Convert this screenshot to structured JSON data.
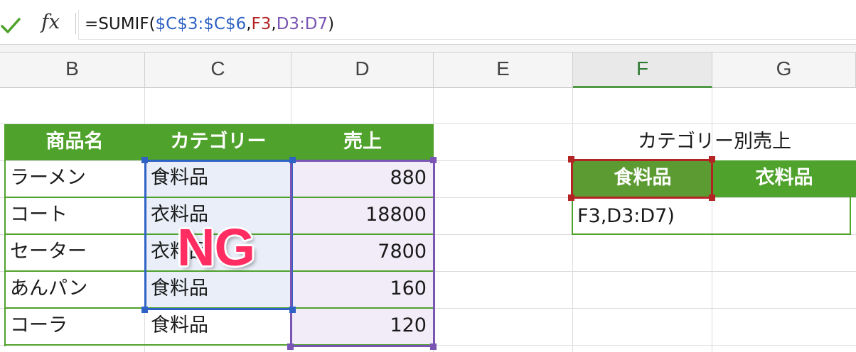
{
  "formula_bar": {
    "check_icon": "checkmark-icon",
    "fx_label": "fx",
    "formula_prefix": "=SUMIF(",
    "formula_ref_range": "$C$3:$C$6",
    "formula_comma1": ",",
    "formula_ref_criteria": "F3",
    "formula_comma2": ",",
    "formula_ref_sum": "D3:D7",
    "formula_suffix": ")"
  },
  "columns": [
    "B",
    "C",
    "D",
    "E",
    "F",
    "G"
  ],
  "selected_column": "F",
  "table": {
    "headers": [
      "商品名",
      "カテゴリー",
      "売上"
    ],
    "rows": [
      {
        "name": "ラーメン",
        "category": "食料品",
        "sales": "880"
      },
      {
        "name": "コート",
        "category": "衣料品",
        "sales": "18800"
      },
      {
        "name": "セーター",
        "category": "衣料品",
        "sales": "7800"
      },
      {
        "name": "あんパン",
        "category": "食料品",
        "sales": "160"
      },
      {
        "name": "コーラ",
        "category": "食料品",
        "sales": "120"
      }
    ]
  },
  "summary": {
    "title": "カテゴリー別売上",
    "headers": [
      "食料品",
      "衣料品"
    ],
    "editing_text": "F3,D3:D7)"
  },
  "overlay": {
    "label": "NG",
    "color": "#ff2d62"
  },
  "colors": {
    "header_green": "#4fa22b",
    "ref_blue": "#2e62c4",
    "ref_red": "#b32524",
    "ref_purple": "#7a55b4"
  }
}
